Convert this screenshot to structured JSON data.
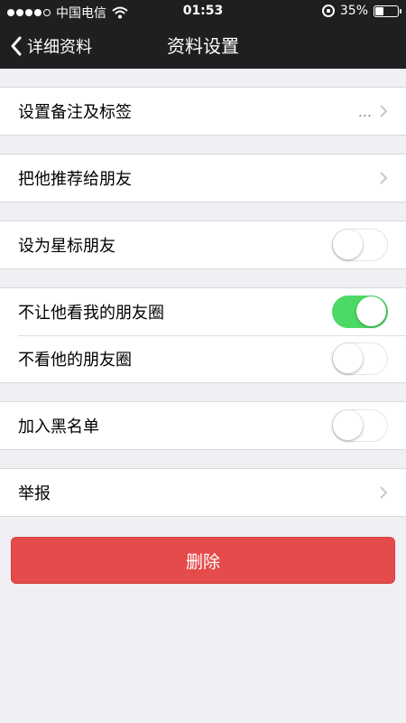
{
  "status": {
    "carrier": "中国电信",
    "time": "01:53",
    "battery": "35%",
    "battery_level": 0.35
  },
  "nav": {
    "back_label": "详细资料",
    "title": "资料设置"
  },
  "groups": [
    {
      "rows": [
        {
          "label": "设置备注及标签",
          "detail": "...",
          "type": "link"
        }
      ]
    },
    {
      "rows": [
        {
          "label": "把他推荐给朋友",
          "type": "link"
        }
      ]
    },
    {
      "rows": [
        {
          "label": "设为星标朋友",
          "type": "toggle",
          "on": false
        }
      ]
    },
    {
      "rows": [
        {
          "label": "不让他看我的朋友圈",
          "type": "toggle",
          "on": true
        },
        {
          "label": "不看他的朋友圈",
          "type": "toggle",
          "on": false
        }
      ]
    },
    {
      "rows": [
        {
          "label": "加入黑名单",
          "type": "toggle",
          "on": false
        }
      ]
    },
    {
      "rows": [
        {
          "label": "举报",
          "type": "link"
        }
      ]
    }
  ],
  "delete_button": "删除",
  "colors": {
    "bar_bg": "#1f1f21",
    "toggle_on": "#4cd964",
    "delete_bg": "#e64b4b",
    "page_bg": "#efeff4"
  }
}
